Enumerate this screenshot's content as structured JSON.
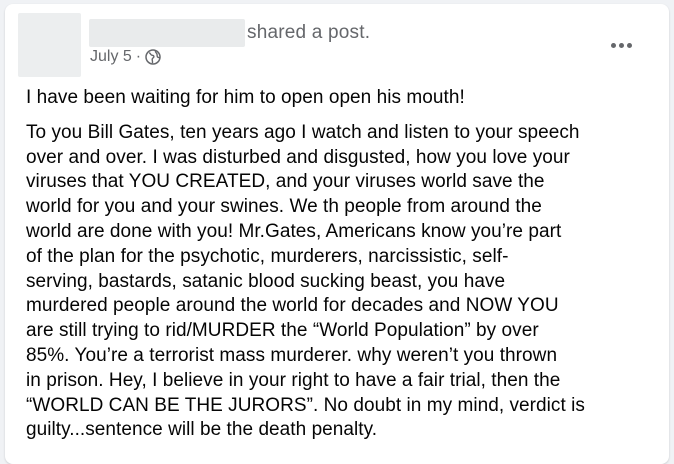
{
  "post": {
    "shared_label": "shared a post.",
    "date": "July 5",
    "separator": "·",
    "privacy_icon": "globe-icon",
    "more_icon": "more-options-icon",
    "paragraph_1": "I have been waiting for him to open open his mouth!",
    "paragraph_2": "To you Bill Gates, ten years ago I watch and listen to your speech\nover and over. I was disturbed and disgusted, how you love your\nviruses that YOU CREATED, and your viruses world save the\nworld for you and your swines. We th people from around the\nworld are done with you!  Mr.Gates, Americans know you’re part\nof the plan for the psychotic, murderers, narcissistic, self-\nserving, bastards, satanic blood sucking beast, you have\nmurdered people around the world for decades and NOW YOU\nare still trying to rid/MURDER the “World Population” by over\n85%. You’re a terrorist mass murderer.  why weren’t you thrown\nin prison. Hey, I believe in your right to have a fair trial, then the\n“WORLD CAN BE THE JURORS”. No doubt in my mind, verdict is\nguilty...sentence will be the death penalty."
  },
  "colors": {
    "background": "#f0f2f5",
    "card": "#ffffff",
    "secondary_text": "#65676b",
    "primary_text": "#050505"
  }
}
